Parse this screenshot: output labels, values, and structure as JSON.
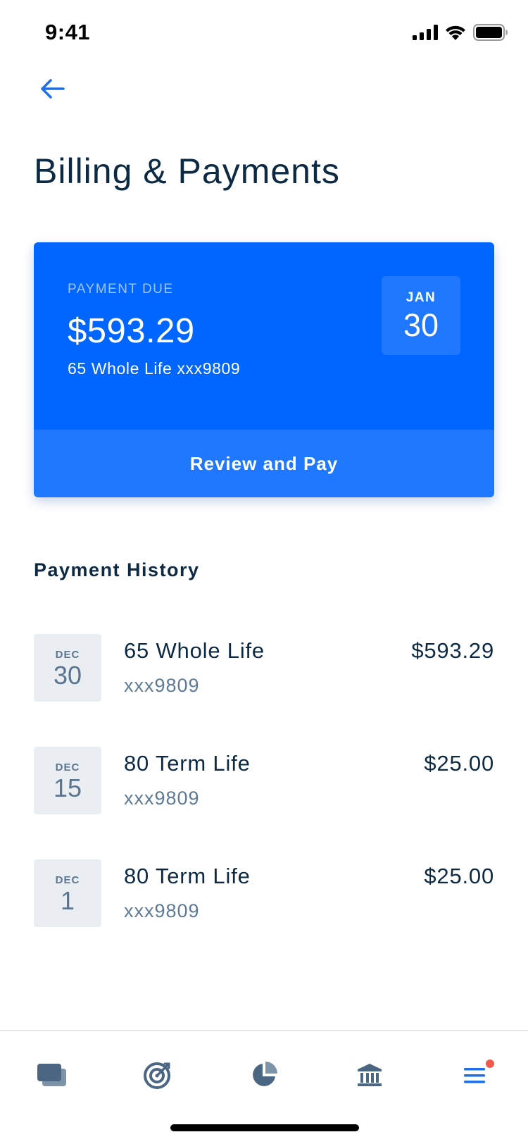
{
  "status_bar": {
    "time": "9:41"
  },
  "header": {
    "title": "Billing & Payments"
  },
  "payment_due": {
    "label": "PAYMENT DUE",
    "amount": "$593.29",
    "policy": "65 Whole Life xxx9809",
    "due_month": "JAN",
    "due_day": "30",
    "action_label": "Review and Pay"
  },
  "history": {
    "heading": "Payment History",
    "items": [
      {
        "month": "DEC",
        "day": "30",
        "name": "65 Whole Life",
        "account": "xxx9809",
        "amount": "$593.29"
      },
      {
        "month": "DEC",
        "day": "15",
        "name": "80 Term Life",
        "account": "xxx9809",
        "amount": "$25.00"
      },
      {
        "month": "DEC",
        "day": "1",
        "name": "80 Term Life",
        "account": "xxx9809",
        "amount": "$25.00"
      }
    ]
  },
  "tab_bar": {
    "tabs": [
      {
        "icon": "cards-icon"
      },
      {
        "icon": "target-icon"
      },
      {
        "icon": "pie-chart-icon"
      },
      {
        "icon": "bank-icon"
      },
      {
        "icon": "menu-icon",
        "active": true,
        "has_notification": true
      }
    ]
  },
  "colors": {
    "primary": "#0066ff",
    "primary_light": "#1f78ff",
    "text_dark": "#0d2a44",
    "text_muted": "#5f7a94",
    "chip_bg": "#eaeef2",
    "notification": "#ef5a4c",
    "tab_icon": "#4b6683"
  }
}
